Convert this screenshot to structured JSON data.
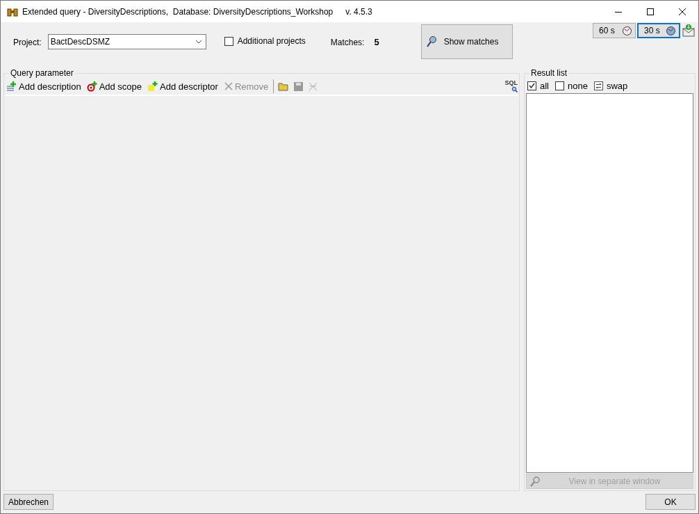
{
  "window": {
    "title": "Extended query - DiversityDescriptions,  Database: DiversityDescriptions_Workshop",
    "version": "v. 4.5.3"
  },
  "project": {
    "label": "Project:",
    "value": "BactDescDSMZ"
  },
  "additional_projects": {
    "label": "Additional projects",
    "checked": false
  },
  "matches": {
    "label": "Matches:",
    "value": "5"
  },
  "show_matches": {
    "label": "Show matches"
  },
  "timers": [
    {
      "label": "60 s",
      "selected": false
    },
    {
      "label": "30 s",
      "selected": true
    }
  ],
  "query_parameter": {
    "title": "Query parameter",
    "toolbar": [
      {
        "kind": "description",
        "label": "Add description",
        "disabled": false
      },
      {
        "kind": "scope",
        "label": "Add scope",
        "disabled": false
      },
      {
        "kind": "descriptor",
        "label": "Add descriptor",
        "disabled": false
      },
      {
        "kind": "remove",
        "label": "Remove",
        "disabled": true
      }
    ],
    "toolbar_icons": [
      {
        "kind": "open",
        "disabled": false
      },
      {
        "kind": "save",
        "disabled": true
      },
      {
        "kind": "clear",
        "disabled": true
      }
    ],
    "sql_label": "SQL"
  },
  "result_list": {
    "title": "Result list",
    "options": [
      {
        "kind": "check",
        "label": "all",
        "checked": true
      },
      {
        "kind": "check",
        "label": "none",
        "checked": false
      },
      {
        "kind": "swap",
        "label": "swap"
      }
    ],
    "view_button": {
      "label": "View in separate window",
      "disabled": true
    }
  },
  "buttons": {
    "cancel": "Abbrechen",
    "ok": "OK"
  }
}
